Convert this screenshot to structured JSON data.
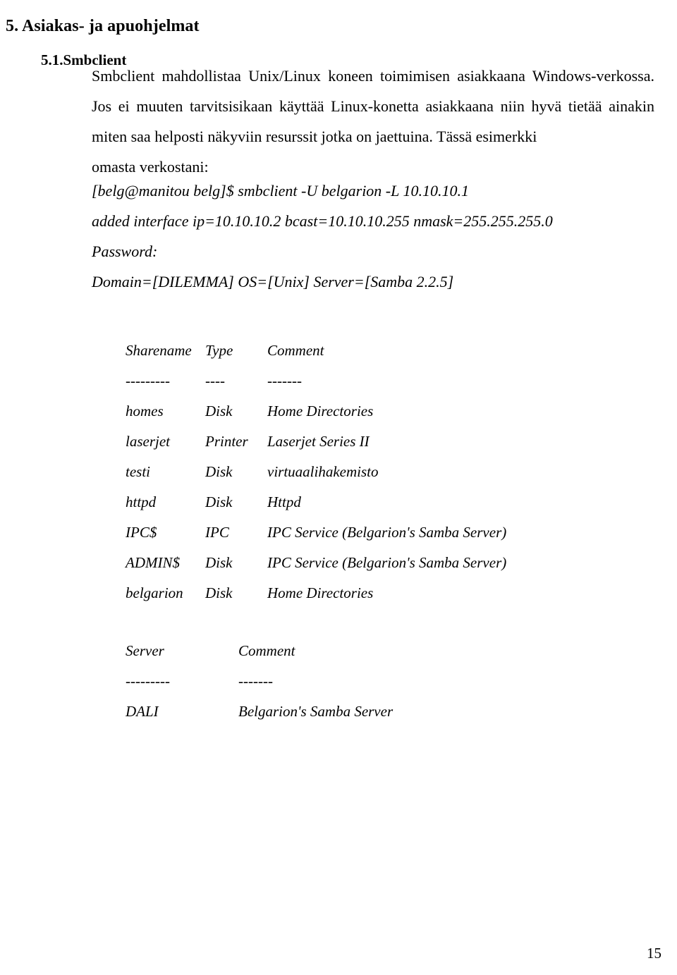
{
  "document": {
    "heading": "5. Asiakas- ja apuohjelmat",
    "subheading": "5.1.Smbclient",
    "body_paragraph": "Smbclient mahdollistaa Unix/Linux koneen toimimisen asiakkaana Windows-verkossa. Jos ei muuten tarvitsisikaan käyttää Linux-konetta asiakkaana niin hyvä tietää ainakin miten saa helposti näkyviin resurssit jotka on jaettuina. Tässä esimerkki",
    "body_last_line": "omasta verkostani:",
    "terminal": {
      "command_line": "[belg@manitou belg]$ smbclient -U belgarion -L 10.10.10.1",
      "interface_line": "added interface ip=10.10.10.2 bcast=10.10.10.255 nmask=255.255.255.0",
      "password_line": "Password:",
      "server_info_line": "Domain=[DILEMMA] OS=[Unix] Server=[Samba 2.2.5]"
    },
    "shares_table": {
      "headers": [
        "Sharename",
        "Type",
        "Comment"
      ],
      "rules": [
        "---------",
        "----",
        "-------"
      ],
      "rows": [
        [
          "homes",
          "Disk",
          "Home Directories"
        ],
        [
          "laserjet",
          "Printer",
          "Laserjet Series II"
        ],
        [
          "testi",
          "Disk",
          "virtuaalihakemisto"
        ],
        [
          "httpd",
          "Disk",
          "Httpd"
        ],
        [
          "IPC$",
          "IPC",
          "IPC Service (Belgarion's Samba Server)"
        ],
        [
          "ADMIN$",
          "Disk",
          "IPC Service (Belgarion's Samba Server)"
        ],
        [
          "belgarion",
          "Disk",
          "Home Directories"
        ]
      ]
    },
    "servers_table": {
      "headers": [
        "Server",
        "Comment"
      ],
      "rules": [
        "---------",
        "-------"
      ],
      "rows": [
        [
          "DALI",
          "Belgarion's Samba Server"
        ]
      ]
    },
    "page_number": "15"
  }
}
